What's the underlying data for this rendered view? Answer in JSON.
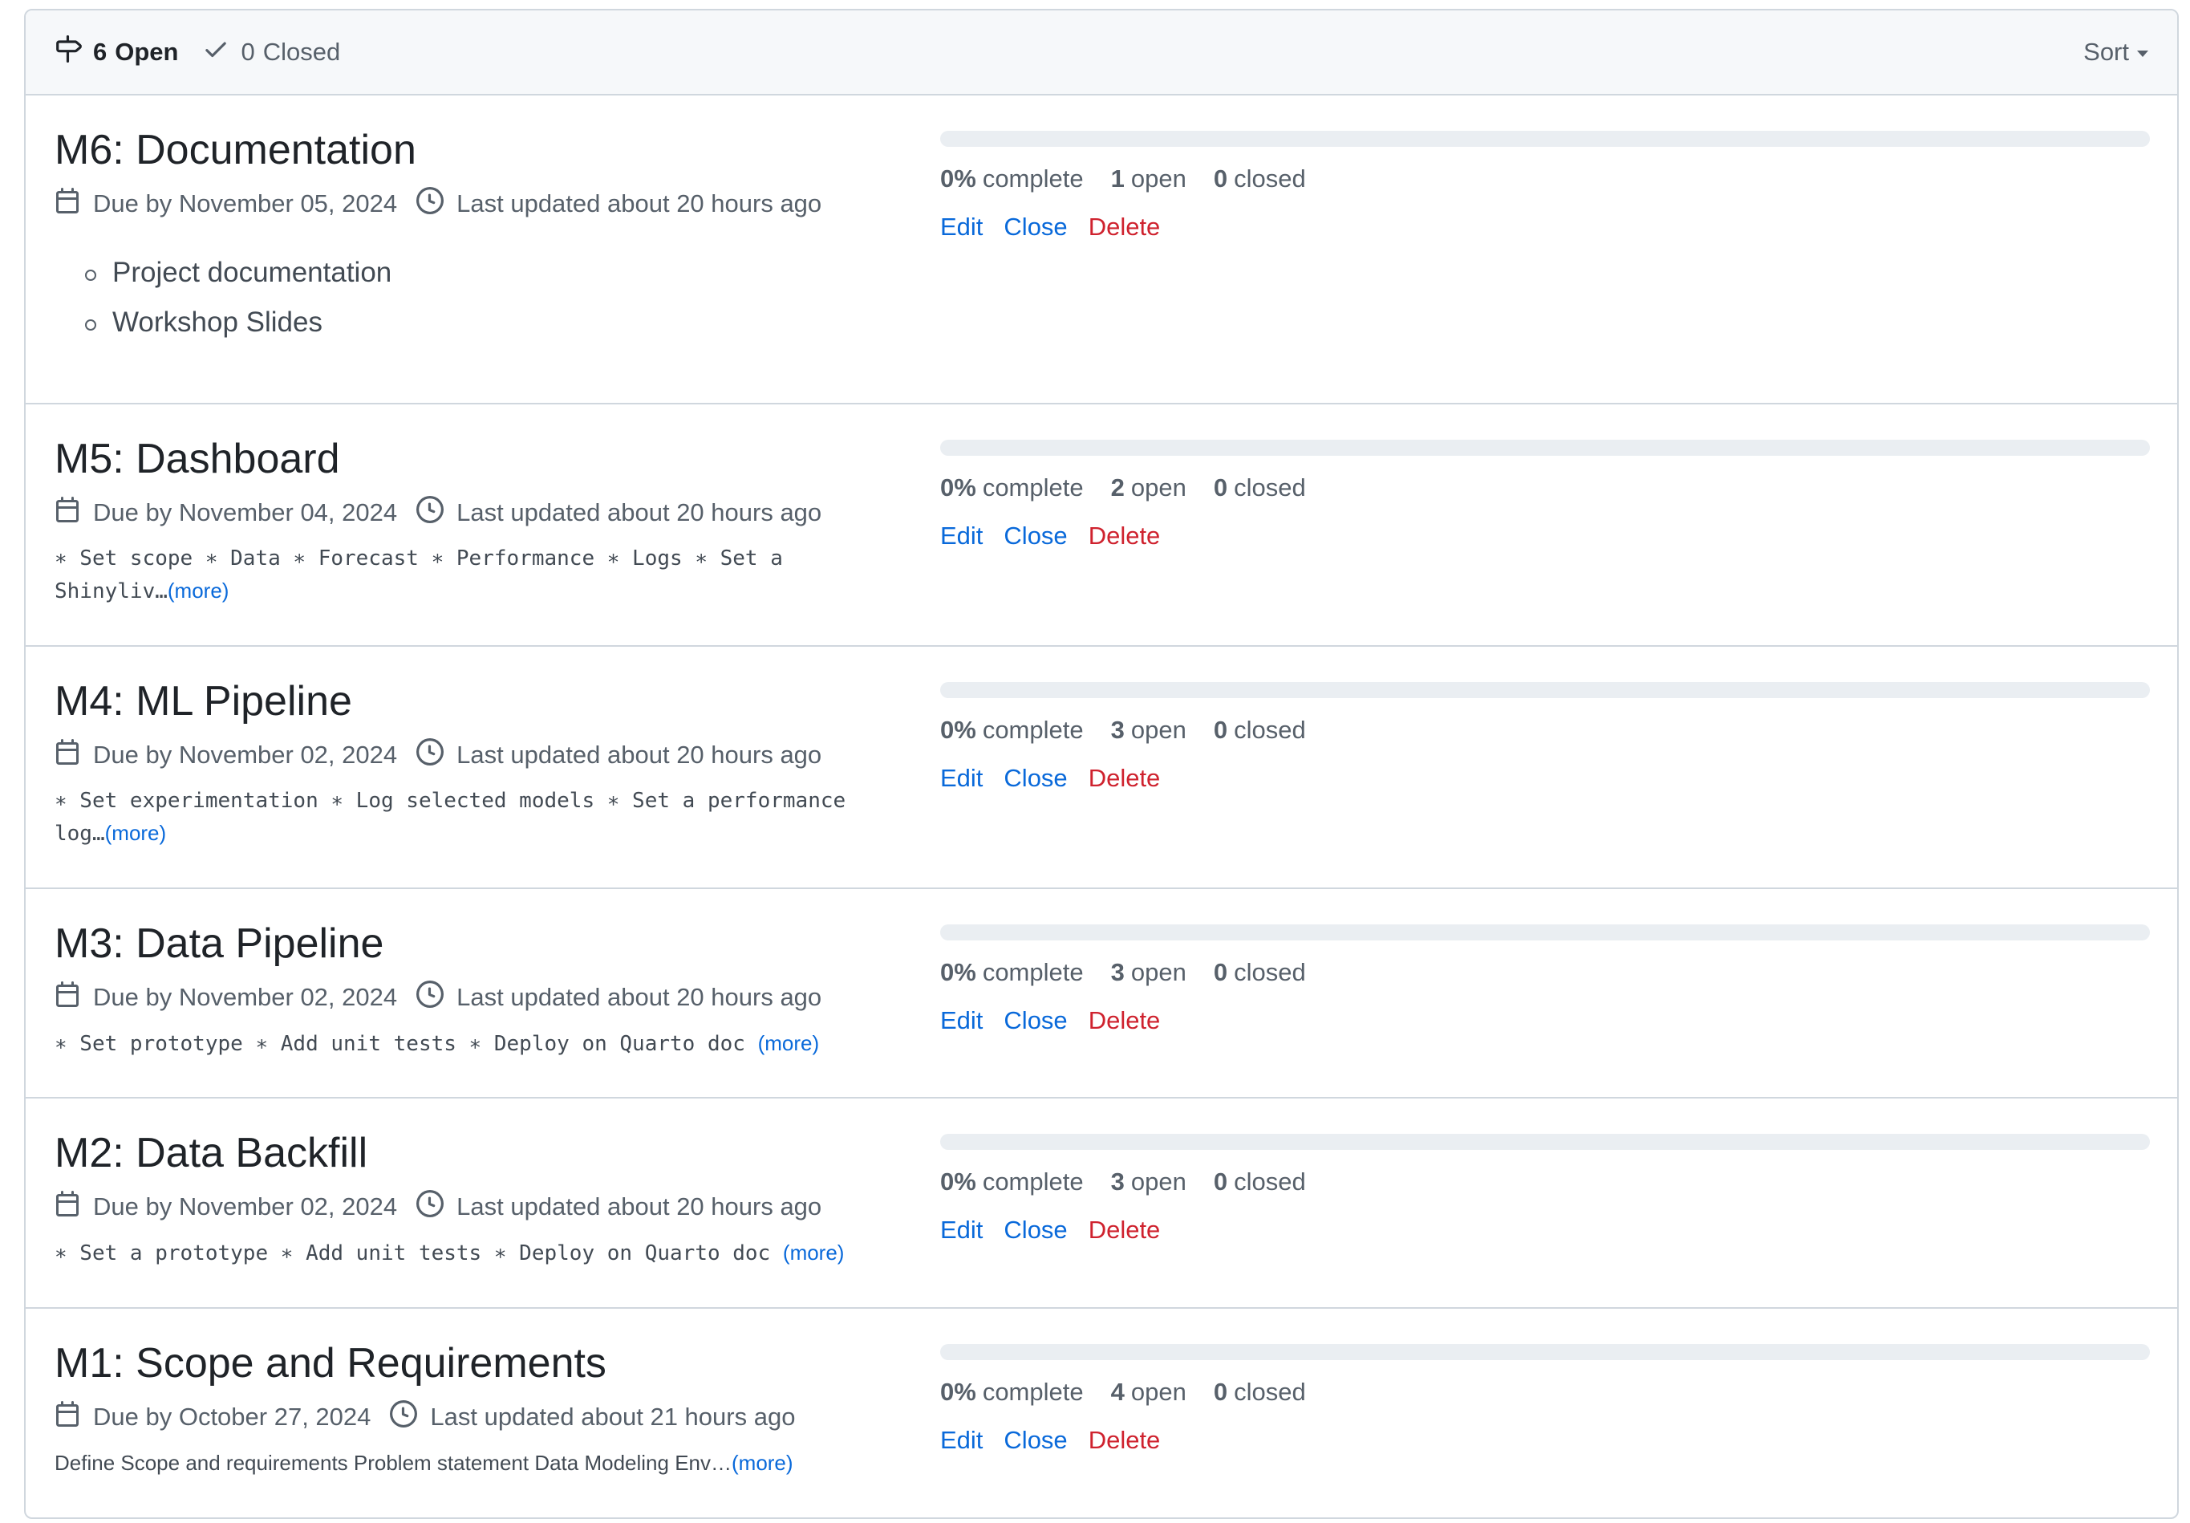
{
  "header": {
    "open_count": "6",
    "open_label": "Open",
    "closed_count": "0",
    "closed_label": "Closed",
    "sort_label": "Sort"
  },
  "milestones": [
    {
      "title": "M6: Documentation",
      "due": "Due by November 05, 2024",
      "updated": "Last updated about 20 hours ago",
      "list": [
        "Project documentation",
        "Workshop Slides"
      ],
      "percent": "0%",
      "percent_label": "complete",
      "open": "1",
      "open_label": "open",
      "closed": "0",
      "closed_label": "closed",
      "progress_fraction": 0,
      "edit": "Edit",
      "close": "Close",
      "delete": "Delete"
    },
    {
      "title": "M5: Dashboard",
      "due": "Due by November 04, 2024",
      "updated": "Last updated about 20 hours ago",
      "desc": "∗ Set scope ∗ Data ∗ Forecast ∗ Performance ∗ Logs ∗ Set a Shinyliv…",
      "more": "(more)",
      "percent": "0%",
      "percent_label": "complete",
      "open": "2",
      "open_label": "open",
      "closed": "0",
      "closed_label": "closed",
      "progress_fraction": 0,
      "edit": "Edit",
      "close": "Close",
      "delete": "Delete"
    },
    {
      "title": "M4: ML Pipeline",
      "due": "Due by November 02, 2024",
      "updated": "Last updated about 20 hours ago",
      "desc": "∗ Set experimentation ∗ Log selected models ∗ Set a performance log…",
      "more": "(more)",
      "percent": "0%",
      "percent_label": "complete",
      "open": "3",
      "open_label": "open",
      "closed": "0",
      "closed_label": "closed",
      "progress_fraction": 0,
      "edit": "Edit",
      "close": "Close",
      "delete": "Delete"
    },
    {
      "title": "M3: Data Pipeline",
      "due": "Due by November 02, 2024",
      "updated": "Last updated about 20 hours ago",
      "desc": "∗ Set prototype ∗ Add unit tests ∗ Deploy on Quarto doc ",
      "more": "(more)",
      "percent": "0%",
      "percent_label": "complete",
      "open": "3",
      "open_label": "open",
      "closed": "0",
      "closed_label": "closed",
      "progress_fraction": 0,
      "edit": "Edit",
      "close": "Close",
      "delete": "Delete"
    },
    {
      "title": "M2: Data Backfill",
      "due": "Due by November 02, 2024",
      "updated": "Last updated about 20 hours ago",
      "desc": "∗ Set a prototype ∗ Add unit tests ∗ Deploy on Quarto doc ",
      "more": "(more)",
      "percent": "0%",
      "percent_label": "complete",
      "open": "3",
      "open_label": "open",
      "closed": "0",
      "closed_label": "closed",
      "progress_fraction": 0,
      "edit": "Edit",
      "close": "Close",
      "delete": "Delete"
    },
    {
      "title": "M1: Scope and Requirements",
      "due": "Due by October 27, 2024",
      "updated": "Last updated about 21 hours ago",
      "desc": "Define Scope and requirements Problem statement Data Modeling Env…",
      "more": "(more)",
      "percent": "0%",
      "percent_label": "complete",
      "open": "4",
      "open_label": "open",
      "closed": "0",
      "closed_label": "closed",
      "progress_fraction": 0,
      "edit": "Edit",
      "close": "Close",
      "delete": "Delete"
    }
  ]
}
